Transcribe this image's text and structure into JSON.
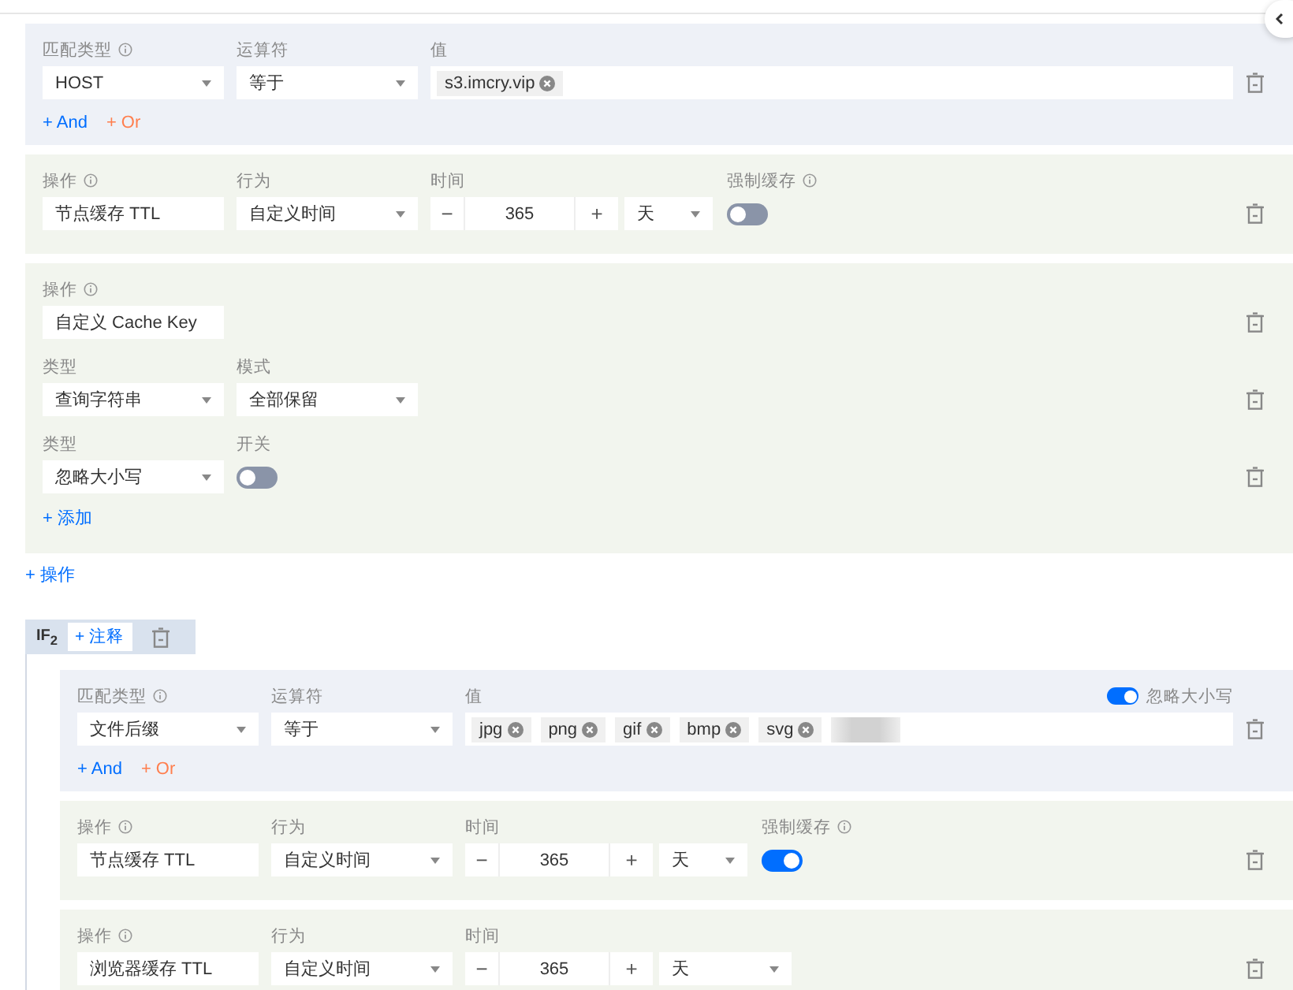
{
  "rules": [
    {
      "blocks": [
        {
          "kind": "condition",
          "match_type": {
            "label": "匹配类型",
            "value": "HOST"
          },
          "operator": {
            "label": "运算符",
            "value": "等于"
          },
          "value": {
            "label": "值",
            "tags": [
              "s3.imcry.vip"
            ]
          },
          "add_and": "+ And",
          "add_or": "+ Or"
        },
        {
          "kind": "action",
          "operation": {
            "label": "操作",
            "value": "节点缓存 TTL"
          },
          "behavior": {
            "label": "行为",
            "value": "自定义时间"
          },
          "time": {
            "label": "时间",
            "minus": "−",
            "value": "365",
            "plus": "+"
          },
          "unit": "天",
          "force_cache": {
            "label": "强制缓存",
            "on": false
          }
        },
        {
          "kind": "cache_key",
          "operation": {
            "label": "操作",
            "value": "自定义 Cache Key"
          },
          "rows": [
            {
              "kind": "select_pair",
              "type": {
                "label": "类型",
                "value": "查询字符串"
              },
              "mode": {
                "label": "模式",
                "value": "全部保留"
              }
            },
            {
              "kind": "switch",
              "type": {
                "label": "类型",
                "value": "忽略大小写"
              },
              "switch": {
                "label": "开关",
                "on": false
              }
            }
          ],
          "add": "+ 添加"
        }
      ],
      "add_action": "+ 操作"
    },
    {
      "header": {
        "title": "IF$_{2}$",
        "comment_button": "+ 注释"
      },
      "blocks": [
        {
          "kind": "condition",
          "match_type": {
            "label": "匹配类型",
            "value": "文件后缀"
          },
          "operator": {
            "label": "运算符",
            "value": "等于"
          },
          "value": {
            "label": "值",
            "tags": [
              "jpg",
              "png",
              "gif",
              "bmp",
              "svg"
            ],
            "blurred_entry": true
          },
          "ignore_case": {
            "label": "忽略大小写",
            "on": true
          },
          "add_and": "+ And",
          "add_or": "+ Or"
        },
        {
          "kind": "action",
          "operation": {
            "label": "操作",
            "value": "节点缓存 TTL"
          },
          "behavior": {
            "label": "行为",
            "value": "自定义时间"
          },
          "time": {
            "label": "时间",
            "minus": "−",
            "value": "365",
            "plus": "+"
          },
          "unit": "天",
          "force_cache": {
            "label": "强制缓存",
            "on": true
          }
        },
        {
          "kind": "action",
          "operation": {
            "label": "操作",
            "value": "浏览器缓存 TTL"
          },
          "behavior": {
            "label": "行为",
            "value": "自定义时间"
          },
          "time": {
            "label": "时间",
            "minus": "−",
            "value": "365",
            "plus": "+"
          },
          "unit": "天"
        }
      ]
    }
  ]
}
